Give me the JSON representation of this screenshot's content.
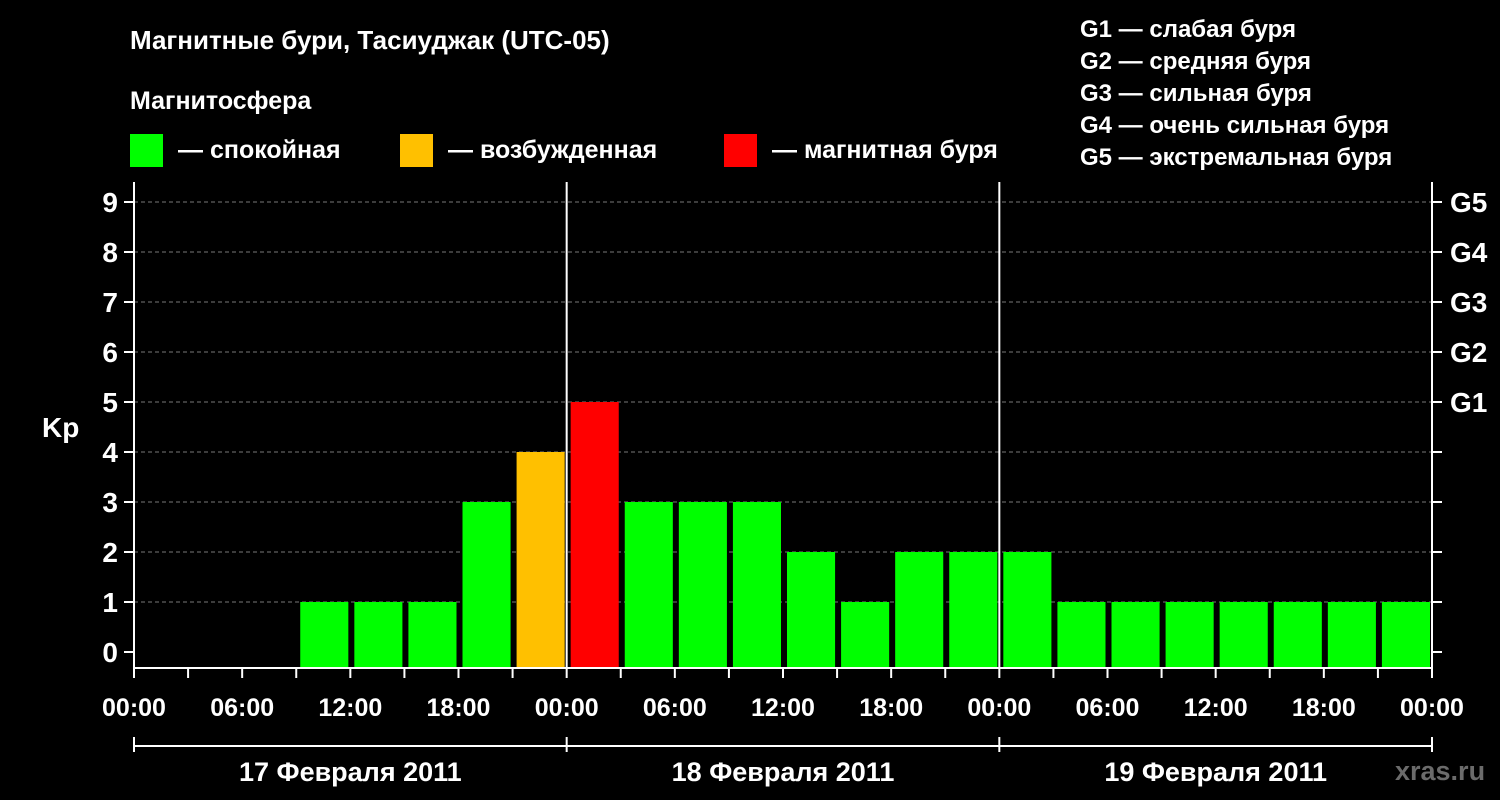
{
  "title": "Магнитные бури, Тасиуджак (UTC-05)",
  "magnetosphere_label": "Магнитосфера",
  "status_legend": [
    {
      "label": "— спокойная",
      "color": "#00ff00"
    },
    {
      "label": "— возбужденная",
      "color": "#ffc000"
    },
    {
      "label": "— магнитная буря",
      "color": "#ff0000"
    }
  ],
  "g_legend": [
    "G1 — слабая буря",
    "G2 — средняя буря",
    "G3 — сильная буря",
    "G4 — очень сильная буря",
    "G5 — экстремальная буря"
  ],
  "watermark": "xras.ru",
  "chart_data": {
    "type": "bar",
    "ylabel": "Kp",
    "ylim": [
      0,
      9
    ],
    "y_ticks": [
      "0",
      "1",
      "2",
      "3",
      "4",
      "5",
      "6",
      "7",
      "8",
      "9"
    ],
    "right_axis_labels": [
      {
        "value": 5,
        "label": "G1"
      },
      {
        "value": 6,
        "label": "G2"
      },
      {
        "value": 7,
        "label": "G3"
      },
      {
        "value": 8,
        "label": "G4"
      },
      {
        "value": 9,
        "label": "G5"
      }
    ],
    "x_tick_labels": [
      "00:00",
      "06:00",
      "12:00",
      "18:00",
      "00:00",
      "06:00",
      "12:00",
      "18:00",
      "00:00",
      "06:00",
      "12:00",
      "18:00",
      "00:00"
    ],
    "dates": [
      "17 Февраля 2011",
      "18 Февраля 2011",
      "19 Февраля 2011"
    ],
    "bar_interval_hours": 3,
    "kp_values": [
      null,
      null,
      null,
      1,
      1,
      1,
      3,
      4,
      5,
      3,
      3,
      3,
      2,
      1,
      2,
      2,
      2,
      1,
      1,
      1,
      1,
      1,
      1,
      1
    ],
    "status_colors": {
      "quiet": "#00ff00",
      "unsettled": "#ffc000",
      "storm": "#ff0000"
    },
    "grid": true
  }
}
